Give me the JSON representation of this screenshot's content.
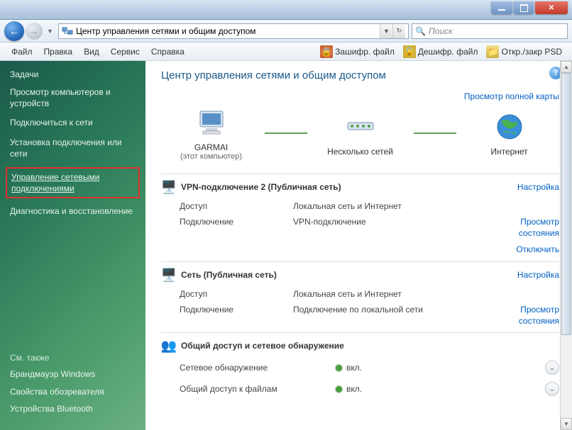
{
  "titlebar": {},
  "navbar": {
    "address": "Центр управления сетями и общим доступом",
    "search_placeholder": "Поиск"
  },
  "menu": {
    "file": "Файл",
    "edit": "Правка",
    "view": "Вид",
    "service": "Сервис",
    "help": "Справка"
  },
  "toolbar": {
    "encrypt": "Зашифр. файл",
    "decrypt": "Дешифр. файл",
    "psd": "Откр./закр PSD"
  },
  "sidebar": {
    "tasks_head": "Задачи",
    "items": [
      "Просмотр компьютеров и устройств",
      "Подключиться к сети",
      "Установка подключения или сети",
      "Управление сетевыми подключениями",
      "Диагностика и восстановление"
    ],
    "see_also_head": "См. также",
    "see_also": [
      "Брандмауэр Windows",
      "Свойства обозревателя",
      "Устройства Bluetooth"
    ]
  },
  "content": {
    "page_title": "Центр управления сетями и общим доступом",
    "full_map": "Просмотр полной карты",
    "node_pc": "GARMAI",
    "node_pc_sub": "(этот компьютер)",
    "node_mid": "Несколько сетей",
    "node_net": "Интернет",
    "vpn": {
      "title": "VPN-подключение  2 (Публичная сеть)",
      "configure": "Настройка",
      "access_k": "Доступ",
      "access_v": "Локальная сеть и Интернет",
      "conn_k": "Подключение",
      "conn_v": "VPN-подключение",
      "view_status": "Просмотр состояния",
      "disconnect": "Отключить"
    },
    "lan": {
      "title": "Сеть (Публичная сеть)",
      "configure": "Настройка",
      "access_k": "Доступ",
      "access_v": "Локальная сеть и Интернет",
      "conn_k": "Подключение",
      "conn_v": "Подключение по локальной сети",
      "view_status": "Просмотр состояния"
    },
    "sharing": {
      "title": "Общий доступ и сетевое обнаружение",
      "rows": [
        {
          "label": "Сетевое обнаружение",
          "status": "вкл."
        },
        {
          "label": "Общий доступ к файлам",
          "status": "вкл."
        }
      ]
    }
  }
}
